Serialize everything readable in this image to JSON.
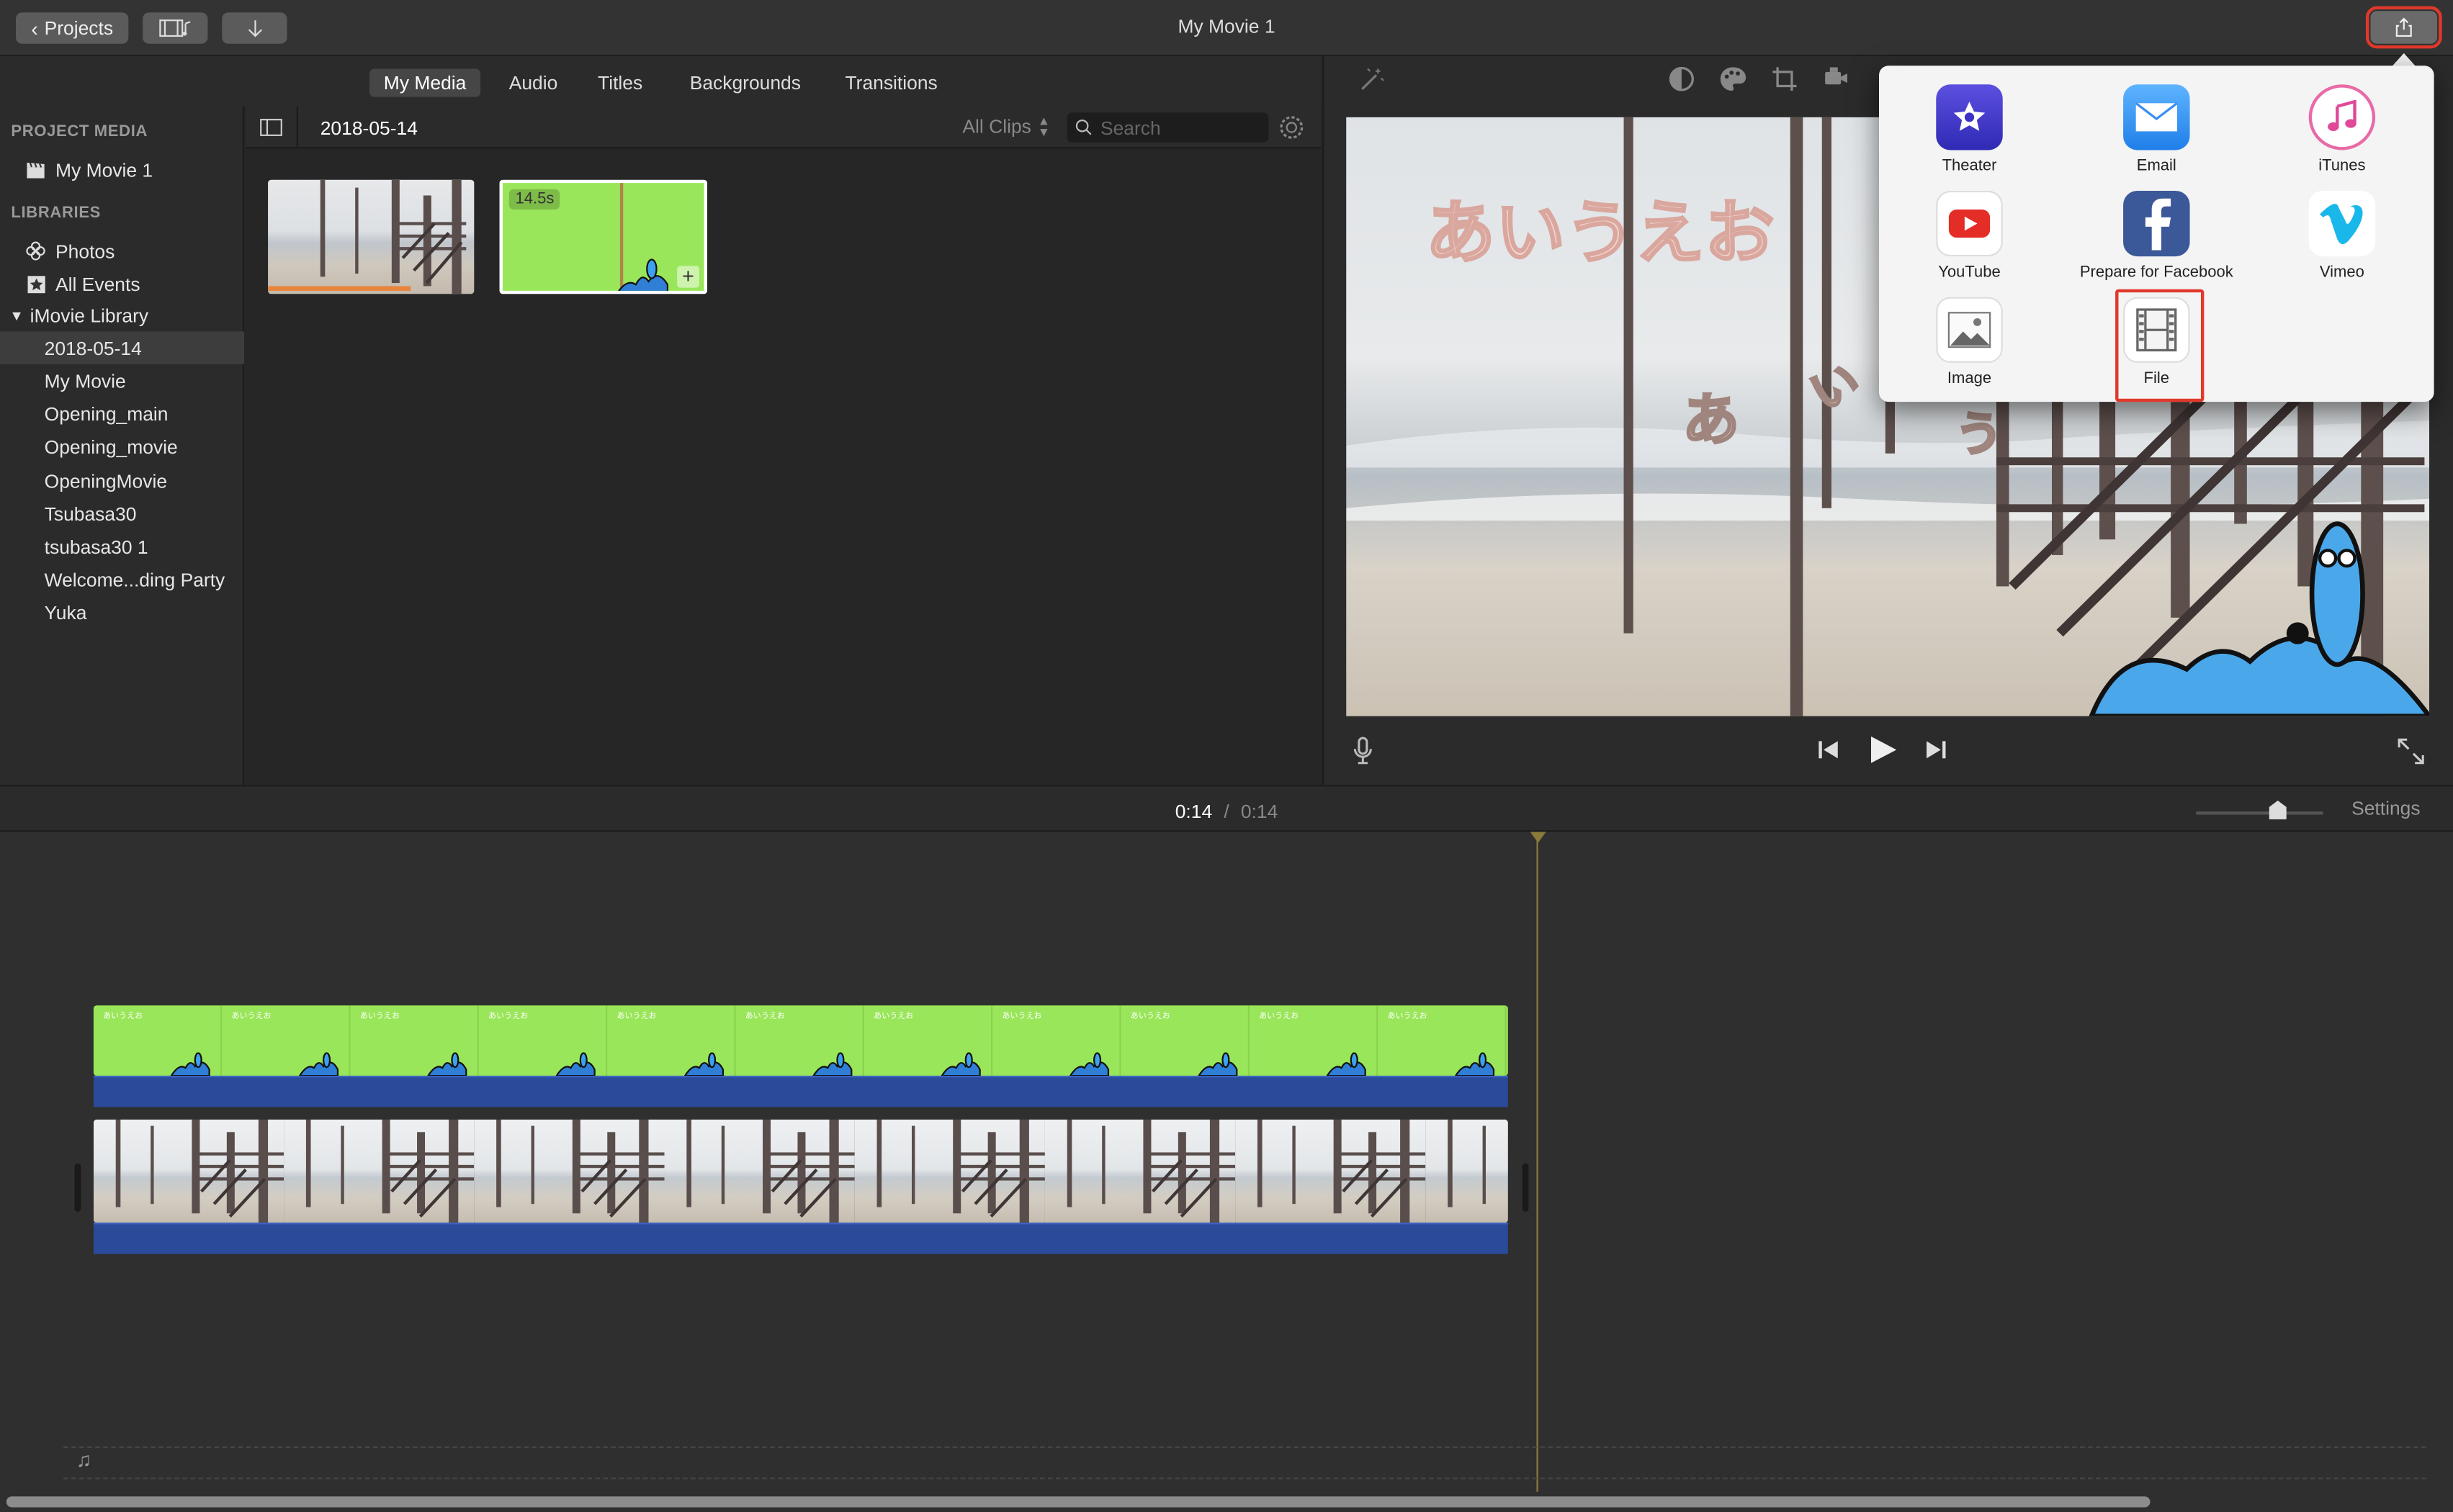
{
  "window": {
    "title": "My Movie 1",
    "projects_label": "Projects"
  },
  "media_tabs": [
    "My Media",
    "Audio",
    "Titles",
    "Backgrounds",
    "Transitions"
  ],
  "sidebar": {
    "project_media_heading": "PROJECT MEDIA",
    "project_item": "My Movie 1",
    "libraries_heading": "LIBRARIES",
    "library_items": [
      "Photos",
      "All Events"
    ],
    "library_name": "iMovie Library",
    "events": [
      "2018-05-14",
      "My Movie",
      "Opening_main",
      "Opening_movie",
      "OpeningMovie",
      "Tsubasa30",
      "tsubasa30 1",
      "Welcome...ding Party",
      "Yuka"
    ],
    "selected_event": "2018-05-14"
  },
  "browser": {
    "event_title": "2018-05-14",
    "filter_label": "All Clips",
    "search_placeholder": "Search",
    "clips": [
      {
        "kind": "beach-video"
      },
      {
        "kind": "title-overlay",
        "duration": "14.5s"
      }
    ]
  },
  "viewer": {
    "overlay_title": "あいうえお",
    "overlay_chars": [
      "あ",
      "い",
      "う"
    ]
  },
  "share_menu": {
    "items": [
      {
        "label": "Theater",
        "icon": "theater-icon"
      },
      {
        "label": "Email",
        "icon": "email-icon"
      },
      {
        "label": "iTunes",
        "icon": "itunes-icon"
      },
      {
        "label": "YouTube",
        "icon": "youtube-icon"
      },
      {
        "label": "Prepare for Facebook",
        "icon": "facebook-icon"
      },
      {
        "label": "Vimeo",
        "icon": "vimeo-icon"
      },
      {
        "label": "Image",
        "icon": "image-icon"
      },
      {
        "label": "File",
        "icon": "film-icon"
      }
    ],
    "highlighted": "File"
  },
  "timeline": {
    "current_time": "0:14",
    "separator": "/",
    "total_time": "0:14",
    "settings_label": "Settings",
    "title_clip_text": "あいうえお",
    "overlay_frames": 11,
    "video_frames": 8
  },
  "colors": {
    "accent_highlight": "#e0392b",
    "title_clip_green": "#9ae65a",
    "audio_blue": "#2a4a9a"
  }
}
